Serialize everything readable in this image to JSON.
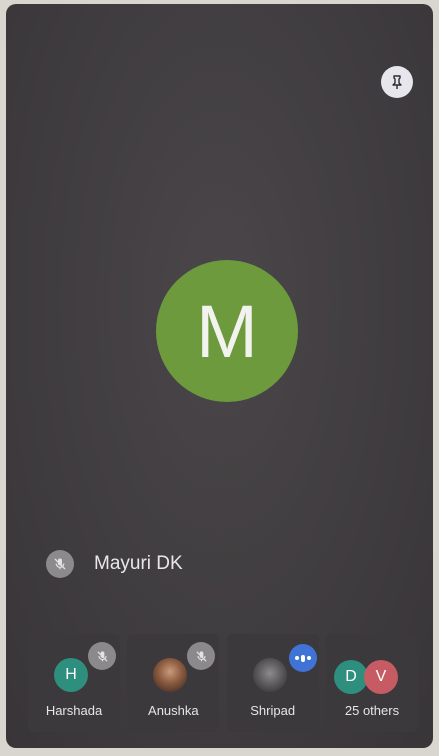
{
  "main": {
    "avatar_letter": "M",
    "avatar_color": "#6e9a3e",
    "speaker_name": "Mayuri DK",
    "pin_icon": "pin-icon"
  },
  "participants": [
    {
      "name": "Harshada",
      "initial": "H",
      "color": "#2e8f7e",
      "status": "muted"
    },
    {
      "name": "Anushka",
      "initial": "",
      "color": "",
      "status": "muted"
    },
    {
      "name": "Shripad",
      "initial": "",
      "color": "",
      "status": "speaking"
    },
    {
      "name": "25 others",
      "initials": [
        "D",
        "V"
      ],
      "colors": [
        "#2e8f7e",
        "#c65b64"
      ]
    }
  ]
}
